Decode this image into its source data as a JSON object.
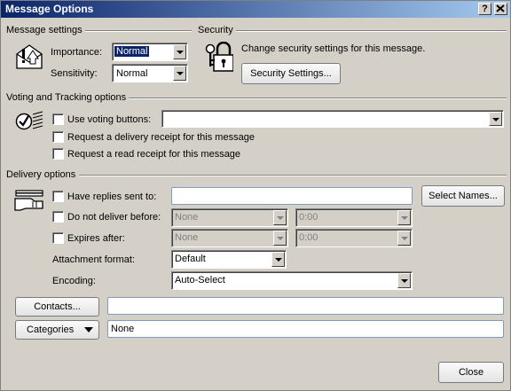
{
  "window": {
    "title": "Message Options",
    "help_glyph": "?",
    "close_glyph": "X"
  },
  "message_settings": {
    "title": "Message settings",
    "importance_label": "Importance:",
    "importance_value": "Normal",
    "sensitivity_label": "Sensitivity:",
    "sensitivity_value": "Normal"
  },
  "security": {
    "title": "Security",
    "description": "Change security settings for this message.",
    "button_label": "Security Settings..."
  },
  "voting": {
    "title": "Voting and Tracking options",
    "use_voting_label": "Use voting buttons:",
    "use_voting_value": "",
    "delivery_receipt_label": "Request a delivery receipt for this message",
    "read_receipt_label": "Request a read receipt for this message"
  },
  "delivery": {
    "title": "Delivery options",
    "replies_label": "Have replies sent to:",
    "replies_value": "",
    "select_names_label": "Select Names...",
    "do_not_deliver_label": "Do not deliver before:",
    "do_not_deliver_date": "None",
    "do_not_deliver_time": "0:00",
    "expires_label": "Expires after:",
    "expires_date": "None",
    "expires_time": "0:00",
    "attachment_format_label": "Attachment format:",
    "attachment_format_value": "Default",
    "encoding_label": "Encoding:",
    "encoding_value": "Auto-Select"
  },
  "contacts": {
    "button_label": "Contacts...",
    "value": ""
  },
  "categories": {
    "button_label": "Categories",
    "value": "None"
  },
  "footer": {
    "close_label": "Close"
  }
}
